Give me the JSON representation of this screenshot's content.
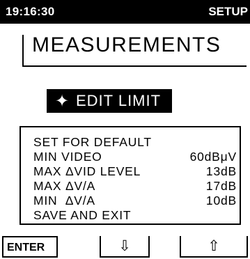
{
  "status_bar": {
    "time": "19:16:30",
    "mode": "SETUP"
  },
  "page": {
    "title": "MEASUREMENTS"
  },
  "mode_banner": {
    "icon": "✦",
    "label": "EDIT LIMIT"
  },
  "menu": {
    "items": [
      {
        "label": "SET FOR DEFAULT",
        "value": ""
      },
      {
        "label": "MIN VIDEO",
        "value": "60dBμV"
      },
      {
        "label": "MAX ΔVID LEVEL",
        "value": "13dB"
      },
      {
        "label": "MAX ΔV/A",
        "value": "17dB"
      },
      {
        "label": "MIN  ΔV/A",
        "value": "10dB"
      },
      {
        "label": "SAVE AND EXIT",
        "value": ""
      }
    ]
  },
  "soft_keys": {
    "enter": "ENTER",
    "down": "⇩",
    "up": "⇧"
  },
  "colors": {
    "background": "#ffffff",
    "foreground": "#000000"
  }
}
